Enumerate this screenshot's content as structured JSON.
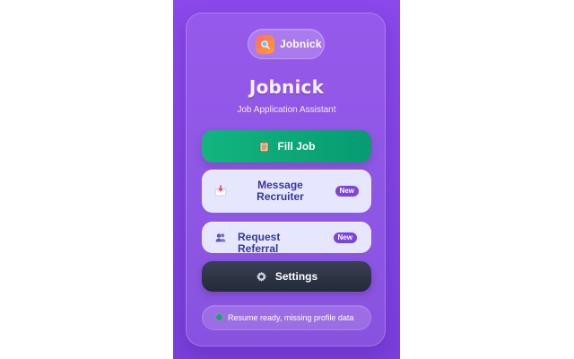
{
  "brand": {
    "name": "Jobnick",
    "logo_icon": "magnifier-icon",
    "logo_colors": [
      "#ff6b6b",
      "#ff9d2b"
    ]
  },
  "header": {
    "title": "Jobnick",
    "subtitle": "Job Application Assistant"
  },
  "buttons": [
    {
      "label": "Fill Job",
      "icon": "clipboard-icon",
      "color": "#079b72"
    },
    {
      "label": "Message Recruiter",
      "icon": "mail-icon",
      "badge": "New",
      "color": "#e6e7ff"
    },
    {
      "label": "Request Referral",
      "icon": "people-icon",
      "badge": "New",
      "color": "#e6e7ff"
    },
    {
      "label": "Settings",
      "icon": "gear-icon",
      "color": "#2b3342"
    }
  ],
  "status": {
    "text": "Resume ready, missing profile data",
    "dot_color": "#21a06d"
  },
  "theme": {
    "background": "#8b48ea",
    "accent": "#7b44e0",
    "text_on_light": "#35399a"
  }
}
